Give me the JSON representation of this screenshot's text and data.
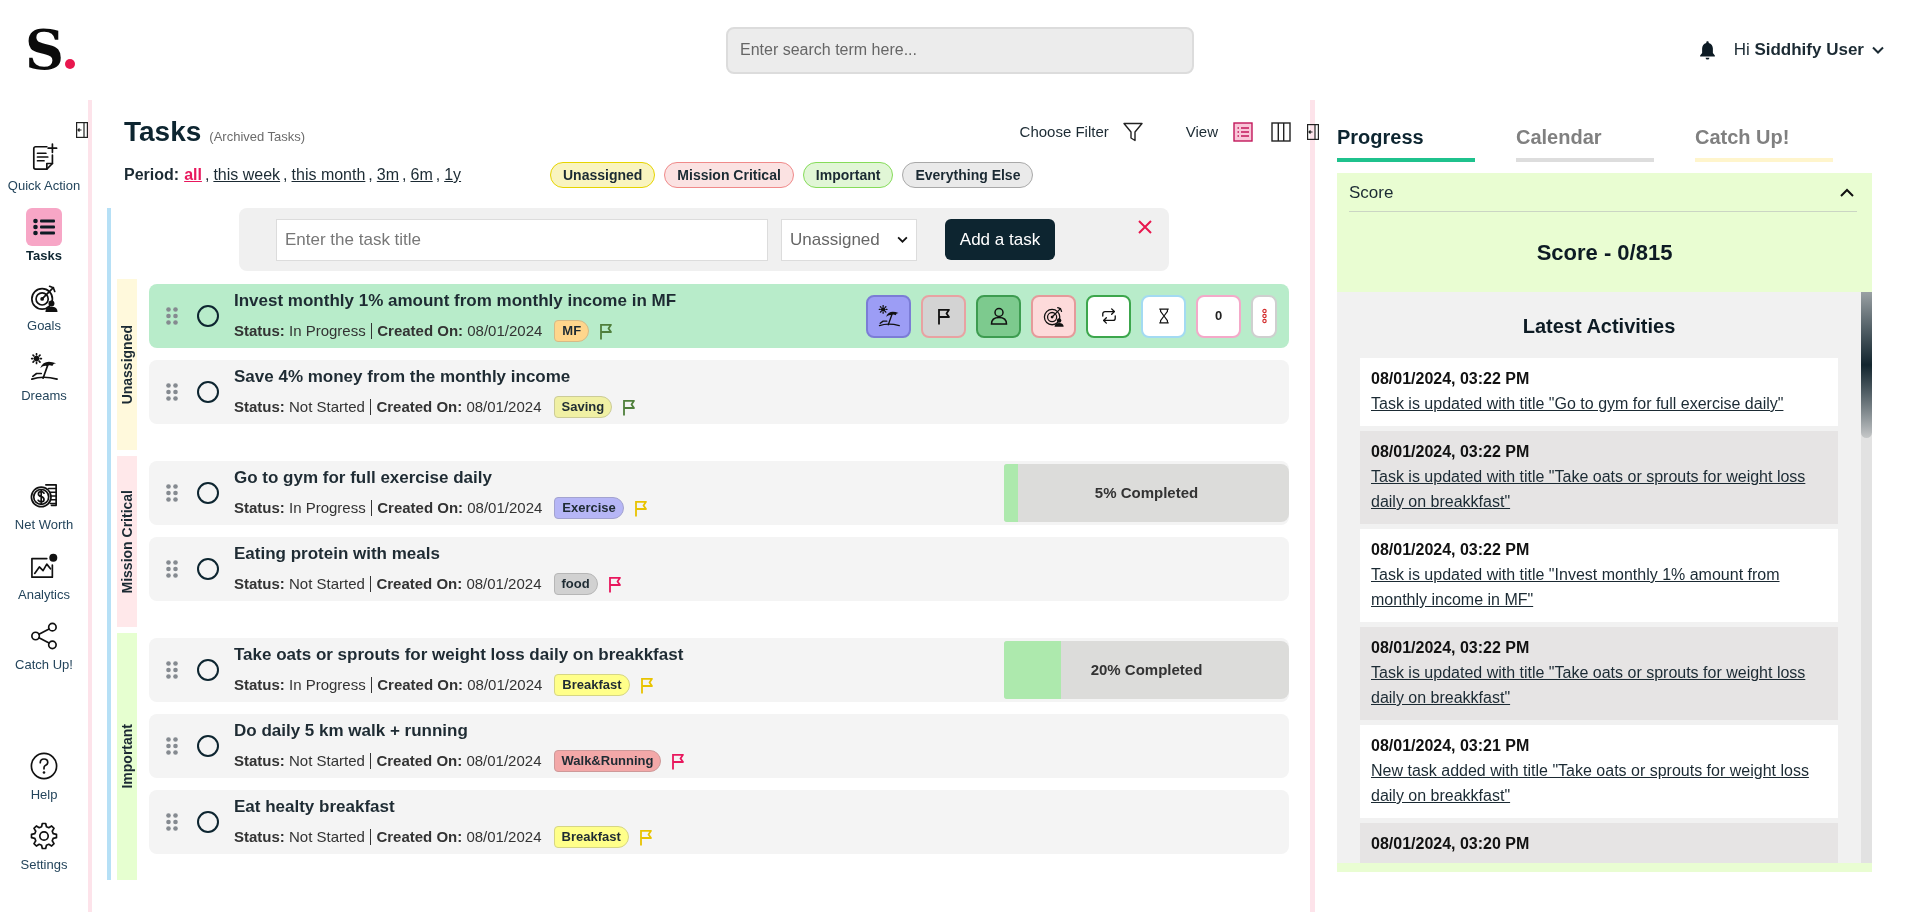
{
  "header": {
    "logo": "S",
    "search": {
      "placeholder": "Enter search term here..."
    },
    "greeting": "Hi **Siddhify User**"
  },
  "sidebar": {
    "top_items": [
      {
        "kind": "quick_action",
        "label": "Quick Action",
        "selected": false
      },
      {
        "kind": "tasks",
        "label": "Tasks",
        "selected": true
      },
      {
        "kind": "goals",
        "label": "Goals",
        "selected": false
      },
      {
        "kind": "dreams",
        "label": "Dreams",
        "selected": false
      }
    ],
    "middle_items": [
      {
        "kind": "net_worth",
        "label": "Net Worth",
        "selected": false
      },
      {
        "kind": "analytics",
        "label": "Analytics",
        "selected": false
      },
      {
        "kind": "catch_up",
        "label": "Catch Up!",
        "selected": false
      }
    ],
    "bottom_items": [
      {
        "kind": "help",
        "label": "Help",
        "selected": false
      },
      {
        "kind": "settings",
        "label": "Settings",
        "selected": false
      }
    ]
  },
  "tasks": {
    "title": "Tasks",
    "subtitle": "(Archived Tasks)",
    "filter_label": "Choose Filter",
    "view": {
      "label": "View",
      "options": [
        {
          "kind": "list",
          "selected": true
        },
        {
          "kind": "board",
          "selected": false
        }
      ]
    },
    "period": {
      "label": "Period:",
      "options": [
        {
          "label": "all",
          "selected": true,
          "sep": ","
        },
        {
          "label": "this week",
          "selected": false,
          "sep": ","
        },
        {
          "label": "this month",
          "selected": false,
          "sep": ","
        },
        {
          "label": "3m",
          "selected": false,
          "sep": ","
        },
        {
          "label": "6m",
          "selected": false,
          "sep": ","
        },
        {
          "label": "1y",
          "selected": false
        }
      ]
    },
    "categories": [
      {
        "label": "Unassigned",
        "color": "#e6d400"
      },
      {
        "label": "Mission Critical",
        "color": "#f08a8a"
      },
      {
        "label": "Important",
        "color": "#86dc5a"
      },
      {
        "label": "Everything Else",
        "color": "#a9a9a9"
      }
    ],
    "new_task": {
      "placeholder": "Enter the task title",
      "category": "Unassigned",
      "button": "Add a task"
    },
    "groups": [
      {
        "name": "Unassigned",
        "color": "#fff9dc",
        "tasks": [
          {
            "title": "Invest monthly 1% amount from monthly income in MF",
            "status": "**Status:** In Progress",
            "created": "**Created On:** 08/01/2024",
            "tag": {
              "label": "MF",
              "color": "#ffd68c"
            },
            "flag": {
              "color": "#4f7f3b"
            },
            "checked": false,
            "selected": true,
            "actions": [
              {
                "kind": "dream"
              },
              {
                "kind": "flag"
              },
              {
                "kind": "assign"
              },
              {
                "kind": "goal"
              },
              {
                "kind": "repeat"
              },
              {
                "kind": "timer"
              },
              {
                "kind": "count",
                "label": "0"
              },
              {
                "kind": "more"
              }
            ]
          },
          {
            "title": "Save 4% money from the monthly income",
            "status": "**Status:** Not Started",
            "created": "**Created On:** 08/01/2024",
            "tag": {
              "label": "Saving",
              "color": "#f0f0a4"
            },
            "flag": {
              "color": "#4f7f3b"
            },
            "checked": false,
            "selected": false
          }
        ]
      },
      {
        "name": "Mission Critical",
        "color": "#ffe8ea",
        "tasks": [
          {
            "title": "Go to gym for full exercise daily",
            "status": "**Status:** In Progress",
            "created": "**Created On:** 08/01/2024",
            "tag": {
              "label": "Exercise",
              "color": "#b6b6f6"
            },
            "flag": {
              "color": "#e8c300"
            },
            "checked": false,
            "selected": false,
            "progress": {
              "level": 0.05,
              "label": "5% Completed"
            }
          },
          {
            "title": "Eating protein with meals",
            "status": "**Status:** Not Started",
            "created": "**Created On:** 08/01/2024",
            "tag": {
              "label": "food",
              "color": "#d1d1d1"
            },
            "flag": {
              "color": "#e8175d"
            },
            "checked": false,
            "selected": false
          }
        ]
      },
      {
        "name": "Important",
        "color": "#e6ffd0",
        "tasks": [
          {
            "title": "Take oats or sprouts for weight loss daily on breakkfast",
            "status": "**Status:** In Progress",
            "created": "**Created On:** 08/01/2024",
            "tag": {
              "label": "Breakfast",
              "color": "#ffff8a"
            },
            "flag": {
              "color": "#e8c300"
            },
            "checked": false,
            "selected": false,
            "progress": {
              "level": 0.2,
              "label": "20% Completed"
            }
          },
          {
            "title": "Do daily 5 km walk + running",
            "status": "**Status:** Not Started",
            "created": "**Created On:** 08/01/2024",
            "tag": {
              "label": "Walk&Running",
              "color": "#f3a8a8"
            },
            "flag": {
              "color": "#e8175d"
            },
            "checked": false,
            "selected": false
          },
          {
            "title": "Eat healty breakfast",
            "status": "**Status:** Not Started",
            "created": "**Created On:** 08/01/2024",
            "tag": {
              "label": "Breakfast",
              "color": "#ffff8a"
            },
            "flag": {
              "color": "#e8c300"
            },
            "checked": false,
            "selected": false
          }
        ]
      }
    ]
  },
  "right_panel": {
    "tabs": [
      {
        "label": "Progress",
        "selected": true,
        "color": "#1fc28d"
      },
      {
        "label": "Calendar",
        "selected": false,
        "color": "#dddddd"
      },
      {
        "label": "Catch Up!",
        "selected": false,
        "color": "#fff5cc"
      }
    ],
    "score": {
      "title": "Score",
      "expanded": true,
      "value": "Score - 0/815"
    },
    "activities": {
      "title": "Latest Activities",
      "items": [
        {
          "time": "08/01/2024, 03:22 PM",
          "text": "Task is updated with title \"Go to gym for full exercise daily\""
        },
        {
          "time": "08/01/2024, 03:22 PM",
          "text": "Task is updated with title \"Take oats or sprouts for weight loss daily on breakkfast\""
        },
        {
          "time": "08/01/2024, 03:22 PM",
          "text": "Task is updated with title \"Invest monthly 1% amount from monthly income in MF\""
        },
        {
          "time": "08/01/2024, 03:22 PM",
          "text": "Task is updated with title \"Take oats or sprouts for weight loss daily on breakkfast\""
        },
        {
          "time": "08/01/2024, 03:21 PM",
          "text": "New task added with title \"Take oats or sprouts for weight loss daily on breakkfast\""
        },
        {
          "time": "08/01/2024, 03:20 PM"
        }
      ]
    }
  }
}
